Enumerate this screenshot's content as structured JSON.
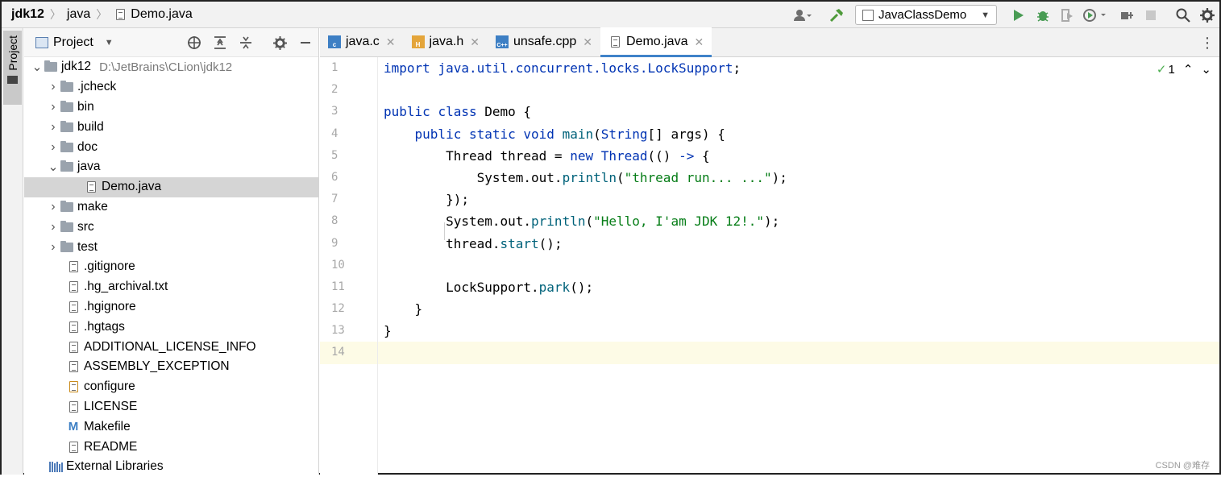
{
  "breadcrumbs": [
    "jdk12",
    "java",
    "Demo.java"
  ],
  "run_config": "JavaClassDemo",
  "toolbar_icons": [
    "user-icon",
    "build-hammer-icon",
    "run-icon",
    "debug-icon",
    "coverage-icon",
    "profile-icon",
    "attach-icon",
    "stop-icon",
    "search-icon",
    "settings-icon"
  ],
  "project_panel": {
    "title": "Project",
    "root_label": "jdk12",
    "root_path": "D:\\JetBrains\\CLion\\jdk12"
  },
  "tree": [
    {
      "label": ".jcheck",
      "type": "folder"
    },
    {
      "label": "bin",
      "type": "folder"
    },
    {
      "label": "build",
      "type": "folder"
    },
    {
      "label": "doc",
      "type": "folder"
    },
    {
      "label": "java",
      "type": "folder-open"
    },
    {
      "label": "Demo.java",
      "type": "file",
      "selected": true
    },
    {
      "label": "make",
      "type": "folder"
    },
    {
      "label": "src",
      "type": "folder"
    },
    {
      "label": "test",
      "type": "folder"
    },
    {
      "label": ".gitignore",
      "type": "ignore"
    },
    {
      "label": ".hg_archival.txt",
      "type": "file"
    },
    {
      "label": ".hgignore",
      "type": "ignore"
    },
    {
      "label": ".hgtags",
      "type": "file"
    },
    {
      "label": "ADDITIONAL_LICENSE_INFO",
      "type": "file"
    },
    {
      "label": "ASSEMBLY_EXCEPTION",
      "type": "file"
    },
    {
      "label": "configure",
      "type": "header"
    },
    {
      "label": "LICENSE",
      "type": "file"
    },
    {
      "label": "Makefile",
      "type": "makefile"
    },
    {
      "label": "README",
      "type": "file"
    },
    {
      "label": "External Libraries",
      "type": "libs"
    }
  ],
  "tabs": [
    {
      "label": "java.c",
      "badge": "c"
    },
    {
      "label": "java.h",
      "badge": "H"
    },
    {
      "label": "unsafe.cpp",
      "badge": "C++"
    },
    {
      "label": "Demo.java",
      "badge": "java",
      "active": true
    }
  ],
  "inspection": {
    "count": "1"
  },
  "code_lines": [
    "import java.util.concurrent.locks.LockSupport;",
    "",
    "public class Demo {",
    "    public static void main(String[] args) {",
    "        Thread thread = new Thread(() -> {",
    "            System.out.println(\"thread run... ...\");",
    "        });",
    "        System.out.println(\"Hello, I'am JDK 12!.\");",
    "        thread.start();",
    "",
    "        LockSupport.park();",
    "    }",
    "}",
    ""
  ],
  "line_numbers": [
    "1",
    "2",
    "3",
    "4",
    "5",
    "6",
    "7",
    "8",
    "9",
    "10",
    "11",
    "12",
    "13",
    "14"
  ],
  "watermark": "CSDN @难存"
}
